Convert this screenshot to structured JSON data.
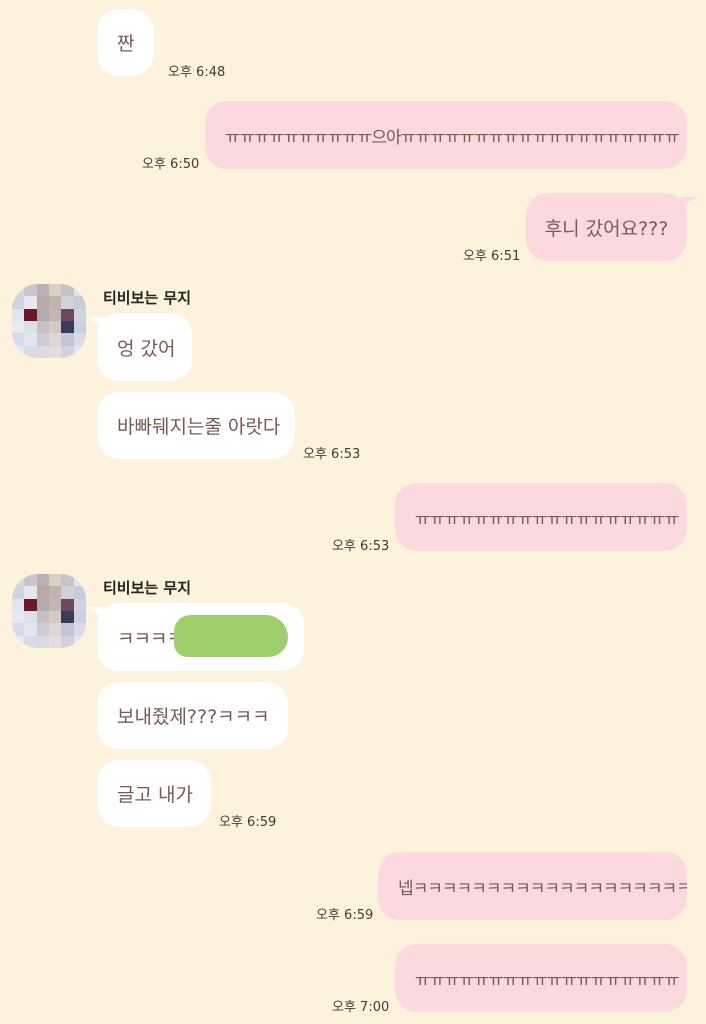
{
  "contact": {
    "name": "티비보는 무지"
  },
  "messages": {
    "m1": {
      "text": "짠",
      "time": "오후 6:48"
    },
    "m2": {
      "text": "ㅠㅠㅠㅠㅠㅠㅠㅠㅠㅠ으아ㅠㅠㅠㅠㅠㅠㅠㅠㅠㅠㅠㅠㅠㅠㅠㅠㅠㅠㅠ",
      "time": "오후 6:50"
    },
    "m3": {
      "text": "후니 갔어요???",
      "time": "오후 6:51"
    },
    "m4": {
      "text": "엉 갔어"
    },
    "m5": {
      "text": "바빠뒈지는줄 아랏다",
      "time": "오후 6:53"
    },
    "m6": {
      "text": "ㅠㅠㅠㅠㅠㅠㅠㅠㅠㅠㅠㅠㅠㅠㅠㅠㅠㅠ",
      "time": "오후 6:53"
    },
    "m7": {
      "text": "ㅋㅋㅋㅋ"
    },
    "m8": {
      "text": "보내줬제???ㅋㅋㅋ"
    },
    "m9": {
      "text": "글고 내가",
      "time": "오후 6:59"
    },
    "m10": {
      "text": "넵ㅋㅋㅋㅋㅋㅋㅋㅋㅋㅋㅋㅋㅋㅋㅋㅋㅋㅋㅋㅋ",
      "time": "오후 6:59"
    },
    "m11": {
      "text": "ㅠㅠㅠㅠㅠㅠㅠㅠㅠㅠㅠㅠㅠㅠㅠㅠㅠㅠ",
      "time": "오후 7:00"
    }
  },
  "colors": {
    "background": "#fdf3dc",
    "incoming_bubble": "#ffffff",
    "outgoing_bubble": "#fbd9de",
    "message_text": "#7a5a56",
    "redaction": "#9fcf6a"
  }
}
